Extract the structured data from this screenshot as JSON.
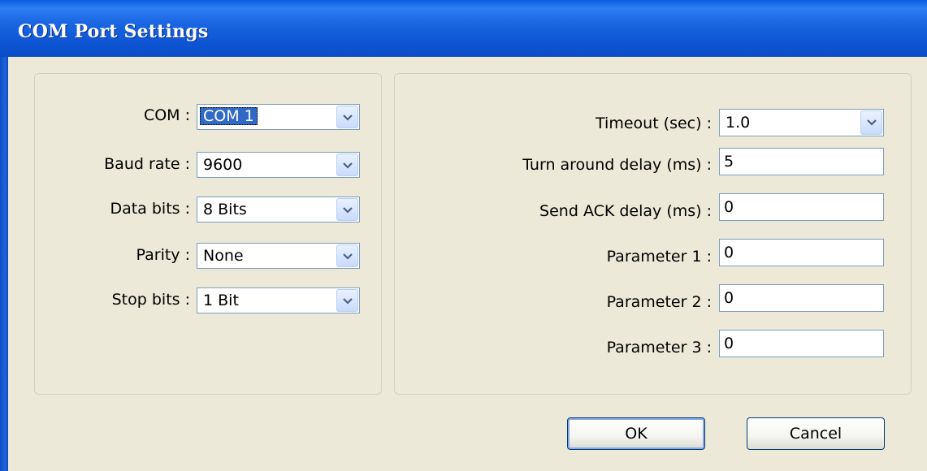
{
  "window": {
    "title": "COM Port Settings"
  },
  "left": {
    "fields": [
      {
        "label": "COM :",
        "value": "COM 1"
      },
      {
        "label": "Baud rate :",
        "value": "9600"
      },
      {
        "label": "Data bits :",
        "value": "8 Bits"
      },
      {
        "label": "Parity :",
        "value": "None"
      },
      {
        "label": "Stop bits :",
        "value": "1 Bit"
      }
    ]
  },
  "right": {
    "timeout": {
      "label": "Timeout (sec) :",
      "value": "1.0"
    },
    "turn_around": {
      "label": "Turn around delay (ms) :",
      "value": "5"
    },
    "send_ack": {
      "label": "Send ACK delay (ms) :",
      "value": "0"
    },
    "param1": {
      "label": "Parameter 1 :",
      "value": "0"
    },
    "param2": {
      "label": "Parameter 2 :",
      "value": "0"
    },
    "param3": {
      "label": "Parameter 3 :",
      "value": "0"
    }
  },
  "buttons": {
    "ok": "OK",
    "cancel": "Cancel"
  },
  "icons": {
    "dropdown": "chevron-down-icon"
  },
  "colors": {
    "titlebar": "#0b53d2",
    "face": "#ece9d8",
    "selection": "#316ac5",
    "field_border": "#7f9db9"
  }
}
